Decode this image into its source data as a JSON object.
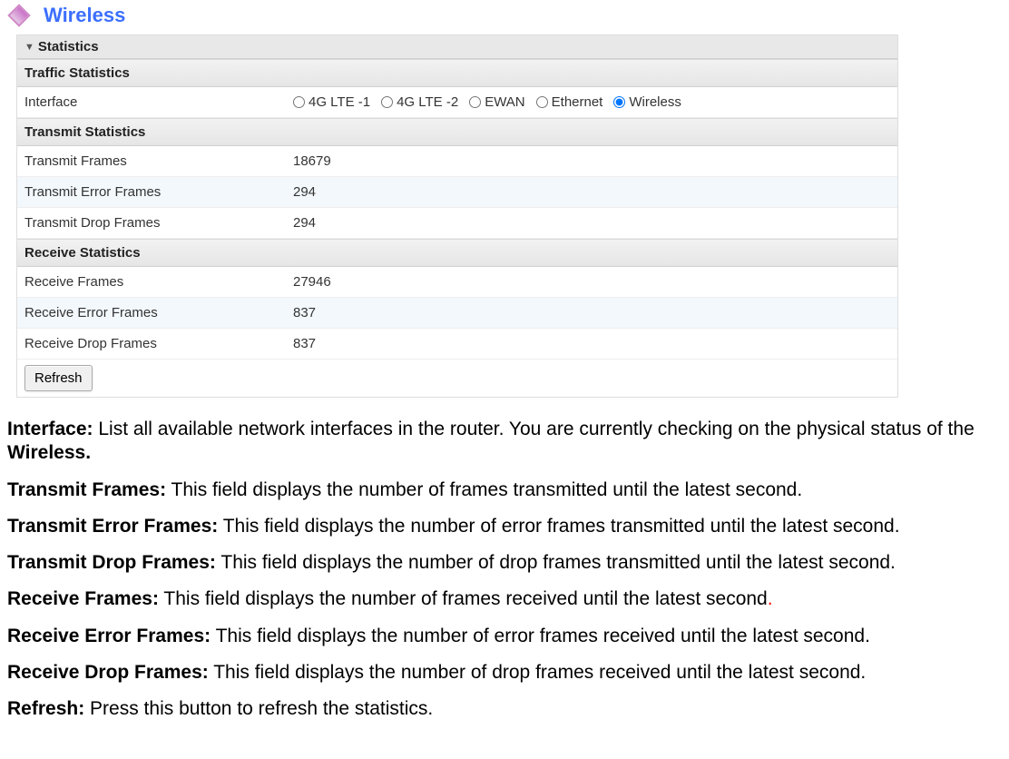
{
  "heading": "Wireless",
  "panel": {
    "title": "Statistics",
    "trafficHeader": "Traffic Statistics",
    "interfaceLabel": "Interface",
    "interfaces": {
      "opt1": "4G LTE -1",
      "opt2": "4G LTE -2",
      "opt3": "EWAN",
      "opt4": "Ethernet",
      "opt5": "Wireless",
      "selected": "Wireless"
    },
    "transmitHeader": "Transmit Statistics",
    "transmit": {
      "framesLabel": "Transmit Frames",
      "framesValue": "18679",
      "errorLabel": "Transmit Error Frames",
      "errorValue": "294",
      "dropLabel": "Transmit Drop Frames",
      "dropValue": "294"
    },
    "receiveHeader": "Receive Statistics",
    "receive": {
      "framesLabel": "Receive Frames",
      "framesValue": "27946",
      "errorLabel": "Receive Error Frames",
      "errorValue": "837",
      "dropLabel": "Receive Drop Frames",
      "dropValue": "837"
    },
    "refreshLabel": "Refresh"
  },
  "desc": {
    "interfaceBold": "Interface:",
    "interfaceText1": " List all available network interfaces in the router.  You are currently checking on the physical status of the ",
    "interfaceBold2": "Wireless.",
    "txFramesBold": "Transmit Frames:",
    "txFramesText": " This field displays the number of frames transmitted until the latest second.",
    "txErrBold": "Transmit Error Frames:",
    "txErrText": " This field displays the number of error frames transmitted until the latest second.",
    "txDropBold": "Transmit Drop Frames:",
    "txDropText": " This field displays the number of drop frames transmitted until the latest second.",
    "rxFramesBold": "Receive Frames:",
    "rxFramesText": " This field displays the number of frames received until the latest second",
    "rxFramesDot": ".",
    "rxErrBold": "Receive Error Frames:",
    "rxErrText": " This field displays the number of error frames received until the latest second.",
    "rxDropBold": "Receive Drop Frames:",
    "rxDropText": " This field displays the number of drop frames received until the latest second.",
    "refreshBold": "Refresh:",
    "refreshText": " Press this button to refresh the statistics."
  }
}
